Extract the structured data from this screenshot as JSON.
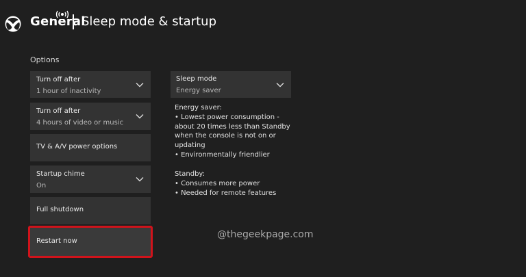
{
  "header": {
    "crumb": "General",
    "title": "Sleep mode & startup"
  },
  "options": {
    "label": "Options",
    "turn_off_after_1": {
      "title": "Turn off after",
      "value": "1 hour of inactivity"
    },
    "turn_off_after_2": {
      "title": "Turn off after",
      "value": "4 hours of video or music"
    },
    "tv_av": {
      "title": "TV & A/V power options"
    },
    "startup_chime": {
      "title": "Startup chime",
      "value": "On"
    },
    "full_shutdown": {
      "title": "Full shutdown"
    },
    "restart_now": {
      "title": "Restart now"
    }
  },
  "sleep_mode": {
    "title": "Sleep mode",
    "value": "Energy saver"
  },
  "description": {
    "energy_saver_heading": "Energy saver:",
    "energy_saver_lines": [
      "• Lowest power consumption -",
      "about 20 times less than Standby",
      "when the console is not on or",
      "updating",
      "• Environmentally friendlier"
    ],
    "standby_heading": "Standby:",
    "standby_lines": [
      "• Consumes more power",
      "• Needed for remote features"
    ]
  },
  "watermark": "@thegeekpage.com",
  "icons": {
    "logo": "xbox-logo-icon",
    "broadcast": "broadcast-icon",
    "chevron": "chevron-down-icon"
  },
  "colors": {
    "background": "#1f1f1f",
    "tile": "#333333",
    "highlight_border": "#d0131b",
    "text": "#eaeaea",
    "subtext": "#b8b8b8"
  }
}
